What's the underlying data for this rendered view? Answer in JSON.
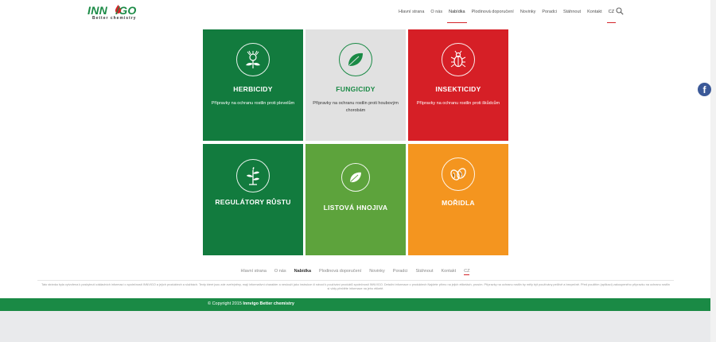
{
  "brand": {
    "logo_text_a": "INN",
    "logo_text_b": "IGO",
    "tagline": "Better chemistry",
    "accent": "#1a8a45",
    "red": "#d4242a"
  },
  "nav": {
    "items": [
      {
        "label": "Hlavní strana"
      },
      {
        "label": "O nás"
      },
      {
        "label": "Nabídka",
        "active": true
      },
      {
        "label": "Plodinová doporučení"
      },
      {
        "label": "Novinky"
      },
      {
        "label": "Poradci"
      },
      {
        "label": "Stáhnout"
      },
      {
        "label": "Kontakt"
      },
      {
        "label": "CZ",
        "active": true
      }
    ],
    "search_icon": "search-icon"
  },
  "tiles": [
    {
      "title": "HERBICIDY",
      "desc": "Přípravky na ochranu rostlin proti plevelům",
      "icon": "thistle-icon",
      "color": "#127b3e"
    },
    {
      "title": "FUNGICIDY",
      "desc": "Přípravky na ochranu rostlin proti houbovým chorobám",
      "icon": "leaf-icon",
      "color": "#e1e1e1"
    },
    {
      "title": "INSEKTICIDY",
      "desc": "Přípravky na ochranu rostlin proti škůdcům",
      "icon": "beetle-icon",
      "color": "#d61f26"
    },
    {
      "title": "REGULÁTORY RŮSTU",
      "desc": "",
      "icon": "sprout-icon",
      "color": "#127b3e"
    },
    {
      "title": "LISTOVÁ HNOJIVA",
      "desc": "",
      "icon": "leaf-icon",
      "color": "#5da33c"
    },
    {
      "title": "MOŘIDLA",
      "desc": "",
      "icon": "seeds-icon",
      "color": "#f4951f"
    }
  ],
  "social": {
    "facebook": "f"
  },
  "footer": {
    "nav": [
      "Hlavní strana",
      "O nás",
      "Nabídka",
      "Plodinová doporučení",
      "Novinky",
      "Poradci",
      "Stáhnout",
      "Kontakt",
      "CZ"
    ],
    "disclaimer_1": "Tato stránka byla vytvořena k poskytnutí základních informací o společnosti INNVIGO a jejích produktech a službách. Texty které jsou zde zveřejněny, mají informativní charakter a neslouží jako instrukce či návod k používání produktů společnosti INNVIGO. Detailní informace o produktech Najdete přímo na jejich etiketách, prosím. Přípravky na ochranu rostlin by měly být používány pečlivě a bezpečně. Před použitím (aplikací) zakoupeného přípravku na ochranu rostlin",
    "disclaimer_2": "si vždy přečtěte informace na jeho etiketě.",
    "copyright_prefix": "© Copyright 2015 ",
    "copyright_brand": "Innvigo Better chemistry"
  }
}
